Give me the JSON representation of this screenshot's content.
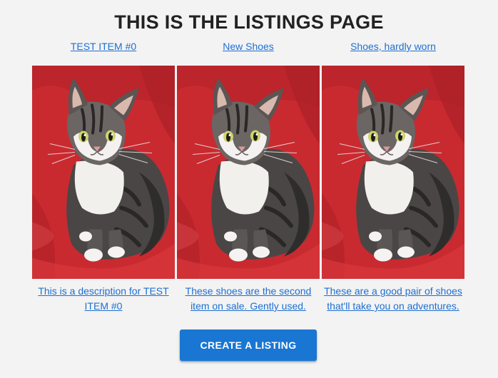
{
  "page": {
    "title": "THIS IS THE LISTINGS PAGE"
  },
  "listings": [
    {
      "title": "TEST ITEM #0",
      "description": "This is a description for TEST ITEM #0",
      "image_icon": "kitten-photo"
    },
    {
      "title": "New Shoes",
      "description": "These shoes are the second item on sale. Gently used.",
      "image_icon": "kitten-photo"
    },
    {
      "title": "Shoes, hardly worn",
      "description": "These are a good pair of shoes that'll take you on adventures.",
      "image_icon": "kitten-photo"
    }
  ],
  "actions": {
    "create_label": "CREATE A LISTING"
  },
  "colors": {
    "background": "#f3f3f3",
    "link": "#1e6fd0",
    "button": "#1976d2",
    "photo_background": "#cf2a2f"
  }
}
